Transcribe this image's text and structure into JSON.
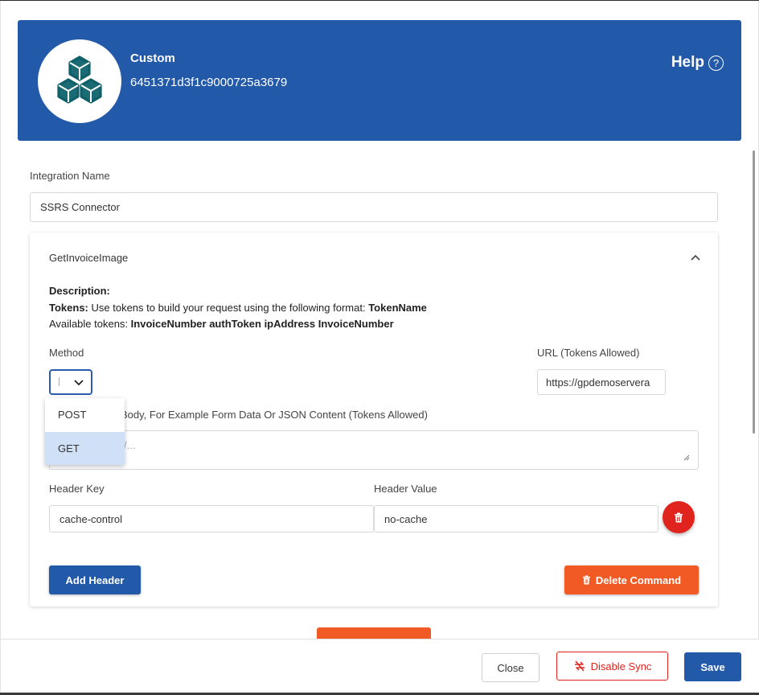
{
  "header": {
    "title": "Custom",
    "id": "6451371d3f1c9000725a3679",
    "help_label": "Help",
    "help_icon": "?"
  },
  "integration": {
    "label": "Integration Name",
    "value": "SSRS Connector"
  },
  "command": {
    "title": "GetInvoiceImage",
    "description_label": "Description:",
    "tokens_label": "Tokens:",
    "tokens_text": " Use tokens to build your request using the following format: ",
    "tokens_format": "TokenName",
    "available_label": "Available tokens: ",
    "available_tokens": "InvoiceNumber authToken ipAddress InvoiceNumber",
    "method_label": "Method",
    "method_options": [
      "POST",
      "GET"
    ],
    "method_highlighted": "GET",
    "url_label": "URL (Tokens Allowed)",
    "url_value": "https://gpdemoservera",
    "body_label": "Body, For Example Form Data Or JSON Content (Tokens Allowed)",
    "body_placeholder": "/...",
    "header_key_label": "Header Key",
    "header_value_label": "Header Value",
    "header_key": "cache-control",
    "header_value": "no-cache",
    "add_header_label": "Add Header",
    "delete_command_label": "Delete Command"
  },
  "footer": {
    "close_label": "Close",
    "disable_sync_label": "Disable Sync",
    "save_label": "Save"
  },
  "colors": {
    "primary": "#2259a8",
    "danger": "#e0231d",
    "accent": "#f15a24"
  }
}
